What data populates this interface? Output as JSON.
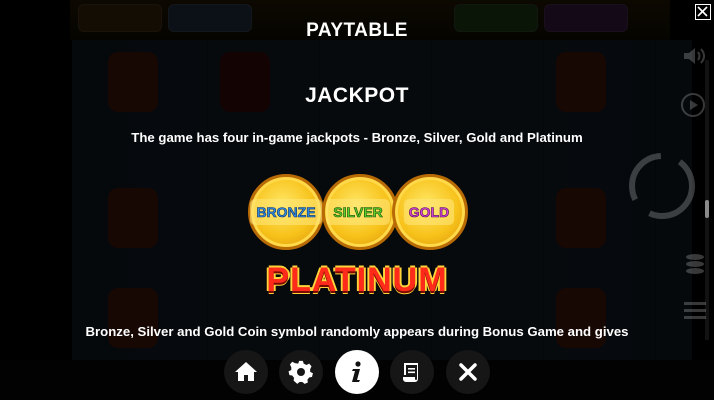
{
  "paytable": {
    "title": "PAYTABLE",
    "section_heading": "JACKPOT",
    "intro_text": "The game has four in-game jackpots - Bronze, Silver, Gold and Platinum",
    "body_text": "Bronze, Silver and Gold Coin symbol randomly appears during Bonus Game and gives"
  },
  "jackpots": {
    "bronze_label": "BRONZE",
    "silver_label": "SILVER",
    "gold_label": "GOLD",
    "platinum_label": "PLATINUM"
  },
  "menu": {
    "items": [
      {
        "name": "home",
        "icon": "home-icon"
      },
      {
        "name": "settings",
        "icon": "gear-icon"
      },
      {
        "name": "info",
        "icon": "info-icon",
        "active": true
      },
      {
        "name": "history",
        "icon": "scroll-icon"
      },
      {
        "name": "close",
        "icon": "close-icon"
      }
    ]
  },
  "colors": {
    "accent_gold": "#f7c21a",
    "platinum_red": "#ff2b1a",
    "bronze_blue": "#2f8fe0",
    "silver_green": "#5bd12a",
    "gold_purple": "#d442d6"
  }
}
